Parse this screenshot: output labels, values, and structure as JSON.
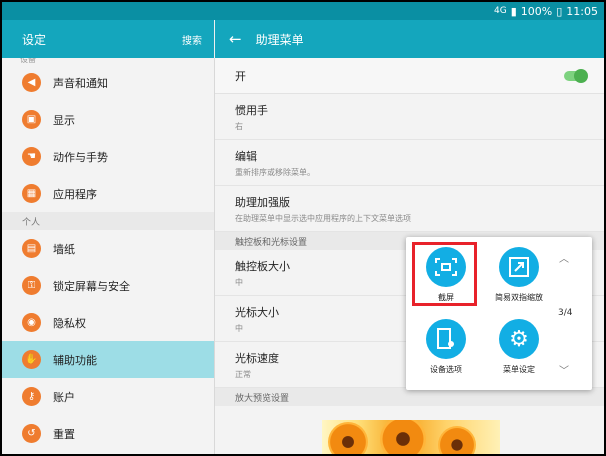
{
  "status_bar": {
    "signal": "4G",
    "battery": "100%",
    "time": "11:05"
  },
  "left_header": {
    "title": "设定",
    "search": "搜索"
  },
  "right_header": {
    "title": "助理菜单"
  },
  "sidebar": {
    "cut_label": "设备",
    "items_top": [
      {
        "label": "声音和通知",
        "icon": "speaker-icon"
      },
      {
        "label": "显示",
        "icon": "display-icon"
      },
      {
        "label": "动作与手势",
        "icon": "gesture-icon"
      },
      {
        "label": "应用程序",
        "icon": "apps-icon"
      }
    ],
    "section": "个人",
    "items_bottom": [
      {
        "label": "墙纸",
        "icon": "wallpaper-icon"
      },
      {
        "label": "锁定屏幕与安全",
        "icon": "lock-icon"
      },
      {
        "label": "隐私权",
        "icon": "privacy-icon"
      },
      {
        "label": "辅助功能",
        "icon": "hand-icon",
        "active": true
      },
      {
        "label": "账户",
        "icon": "key-icon"
      },
      {
        "label": "重置",
        "icon": "reset-icon"
      }
    ]
  },
  "main": {
    "toggle_label": "开",
    "settings": [
      {
        "title": "惯用手",
        "sub": "右"
      },
      {
        "title": "编辑",
        "sub": "重新排序或移除菜单。"
      },
      {
        "title": "助理加强版",
        "sub": "在助理菜单中显示选中应用程序的上下文菜单选项"
      }
    ],
    "section1": "触控板和光标设置",
    "settings2": [
      {
        "title": "触控板大小",
        "sub": "中"
      },
      {
        "title": "光标大小",
        "sub": "中"
      },
      {
        "title": "光标速度",
        "sub": "正常"
      }
    ],
    "section2": "放大预览设置"
  },
  "popup": {
    "items": [
      {
        "label": "截屏",
        "icon": "screenshot-icon"
      },
      {
        "label": "简易双指缩放",
        "icon": "zoom-icon"
      },
      {
        "label": "设备选项",
        "icon": "device-options-icon"
      },
      {
        "label": "菜单设定",
        "icon": "settings-gear-icon"
      }
    ],
    "page": "3/4"
  },
  "colors": {
    "header": "#14a6bd",
    "accent_icon": "#ef7c2f",
    "active_row": "#9ddde6",
    "popup_button": "#12aee4",
    "highlight": "#e8222a"
  }
}
